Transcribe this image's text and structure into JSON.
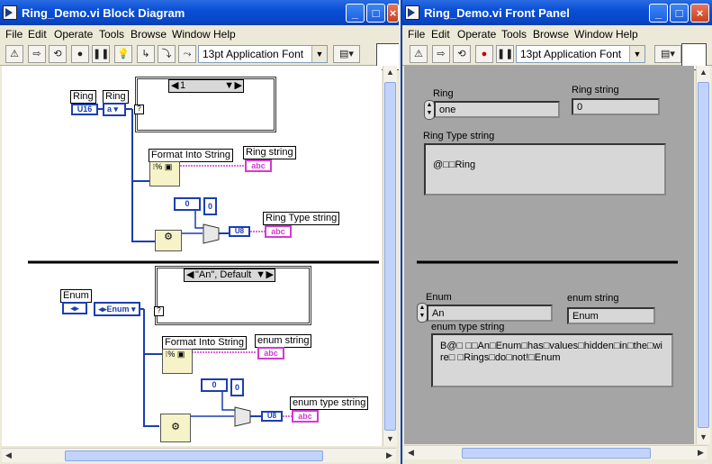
{
  "bd_window": {
    "title": "Ring_Demo.vi Block Diagram",
    "menu": [
      "File",
      "Edit",
      "Operate",
      "Tools",
      "Browse",
      "Window",
      "Help"
    ],
    "font_select": "13pt Application Font"
  },
  "fp_window": {
    "title": "Ring_Demo.vi Front Panel",
    "menu": [
      "File",
      "Edit",
      "Operate",
      "Tools",
      "Browse",
      "Window",
      "Help"
    ],
    "font_select": "13pt Application Font"
  },
  "diagram": {
    "top": {
      "ring_const_label": "Ring",
      "ring_const_value": "U16",
      "ring_ctrl_label": "Ring",
      "ring_ctrl_value": "a",
      "case_selector": "1",
      "format_label": "Format Into String",
      "ring_string_label": "Ring string",
      "indicator_glyph": "abc",
      "num_const": "0",
      "ring_type_string_label": "Ring Type string"
    },
    "bottom": {
      "enum_label": "Enum",
      "enum_value": "Enum",
      "case_selector": "\"An\", Default",
      "format_label": "Format Into String",
      "enum_string_label": "enum string",
      "num_const": "0",
      "enum_type_string_label": "enum type string",
      "indicator_glyph": "abc"
    }
  },
  "panel": {
    "ring_label": "Ring",
    "ring_value": "one",
    "ring_string_label": "Ring string",
    "ring_string_value": "0",
    "ring_type_label": "Ring Type string",
    "ring_type_value": "@□□Ring",
    "enum_label": "Enum",
    "enum_value": "An",
    "enum_string_label": "enum string",
    "enum_string_value": "Enum",
    "enum_type_label": "enum type string",
    "enum_type_value": "B@□ □□An□Enum□has□values□hidden□in□the□wire□ □Rings□do□not!□Enum"
  },
  "colors": {
    "titlebar": "#0a4fd6",
    "wire_int": "#1a3fb0",
    "wire_string": "#d23ad2"
  }
}
